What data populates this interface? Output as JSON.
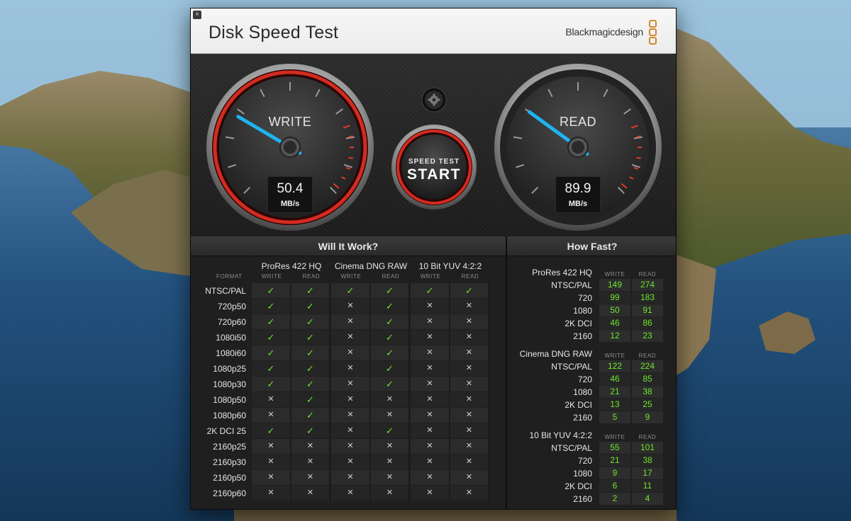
{
  "window": {
    "title": "Disk Speed Test",
    "brand": "Blackmagicdesign",
    "close_label": "×"
  },
  "gauges": {
    "write": {
      "label": "WRITE",
      "value": "50.4",
      "unit": "MB/s",
      "needle_fraction": 0.28
    },
    "read": {
      "label": "READ",
      "value": "89.9",
      "unit": "MB/s",
      "needle_fraction": 0.3
    }
  },
  "start_button": {
    "small_label": "SPEED TEST",
    "big_label": "START"
  },
  "settings_button": {
    "icon": "gear-icon"
  },
  "will_it_work": {
    "title": "Will It Work?",
    "format_header": "FORMAT",
    "groups": [
      {
        "name": "ProRes 422 HQ",
        "write": "WRITE",
        "read": "READ"
      },
      {
        "name": "Cinema DNG RAW",
        "write": "WRITE",
        "read": "READ"
      },
      {
        "name": "10 Bit YUV 4:2:2",
        "write": "WRITE",
        "read": "READ"
      }
    ],
    "ok_symbol": "✓",
    "no_symbol": "✕",
    "rows": [
      {
        "format": "NTSC/PAL",
        "cells": [
          1,
          1,
          1,
          1,
          1,
          1
        ]
      },
      {
        "format": "720p50",
        "cells": [
          1,
          1,
          0,
          1,
          0,
          0
        ]
      },
      {
        "format": "720p60",
        "cells": [
          1,
          1,
          0,
          1,
          0,
          0
        ]
      },
      {
        "format": "1080i50",
        "cells": [
          1,
          1,
          0,
          1,
          0,
          0
        ]
      },
      {
        "format": "1080i60",
        "cells": [
          1,
          1,
          0,
          1,
          0,
          0
        ]
      },
      {
        "format": "1080p25",
        "cells": [
          1,
          1,
          0,
          1,
          0,
          0
        ]
      },
      {
        "format": "1080p30",
        "cells": [
          1,
          1,
          0,
          1,
          0,
          0
        ]
      },
      {
        "format": "1080p50",
        "cells": [
          0,
          1,
          0,
          0,
          0,
          0
        ]
      },
      {
        "format": "1080p60",
        "cells": [
          0,
          1,
          0,
          0,
          0,
          0
        ]
      },
      {
        "format": "2K DCI 25",
        "cells": [
          1,
          1,
          0,
          1,
          0,
          0
        ]
      },
      {
        "format": "2160p25",
        "cells": [
          0,
          0,
          0,
          0,
          0,
          0
        ]
      },
      {
        "format": "2160p30",
        "cells": [
          0,
          0,
          0,
          0,
          0,
          0
        ]
      },
      {
        "format": "2160p50",
        "cells": [
          0,
          0,
          0,
          0,
          0,
          0
        ]
      },
      {
        "format": "2160p60",
        "cells": [
          0,
          0,
          0,
          0,
          0,
          0
        ]
      }
    ]
  },
  "how_fast": {
    "title": "How Fast?",
    "groups": [
      {
        "name": "ProRes 422 HQ",
        "write": "WRITE",
        "read": "READ",
        "rows": [
          {
            "format": "NTSC/PAL",
            "write": "149",
            "read": "274"
          },
          {
            "format": "720",
            "write": "99",
            "read": "183"
          },
          {
            "format": "1080",
            "write": "50",
            "read": "91"
          },
          {
            "format": "2K DCI",
            "write": "46",
            "read": "86"
          },
          {
            "format": "2160",
            "write": "12",
            "read": "23"
          }
        ]
      },
      {
        "name": "Cinema DNG RAW",
        "write": "WRITE",
        "read": "READ",
        "rows": [
          {
            "format": "NTSC/PAL",
            "write": "122",
            "read": "224"
          },
          {
            "format": "720",
            "write": "46",
            "read": "85"
          },
          {
            "format": "1080",
            "write": "21",
            "read": "38"
          },
          {
            "format": "2K DCI",
            "write": "13",
            "read": "25"
          },
          {
            "format": "2160",
            "write": "5",
            "read": "9"
          }
        ]
      },
      {
        "name": "10 Bit YUV 4:2:2",
        "write": "WRITE",
        "read": "READ",
        "rows": [
          {
            "format": "NTSC/PAL",
            "write": "55",
            "read": "101"
          },
          {
            "format": "720",
            "write": "21",
            "read": "38"
          },
          {
            "format": "1080",
            "write": "9",
            "read": "17"
          },
          {
            "format": "2K DCI",
            "write": "6",
            "read": "11"
          },
          {
            "format": "2160",
            "write": "2",
            "read": "4"
          }
        ]
      }
    ]
  },
  "colors": {
    "accent_green": "#6ee62a",
    "needle_blue": "#1fb3f0",
    "ring_red": "#c0241c",
    "brand_orange": "#d08a2e"
  }
}
